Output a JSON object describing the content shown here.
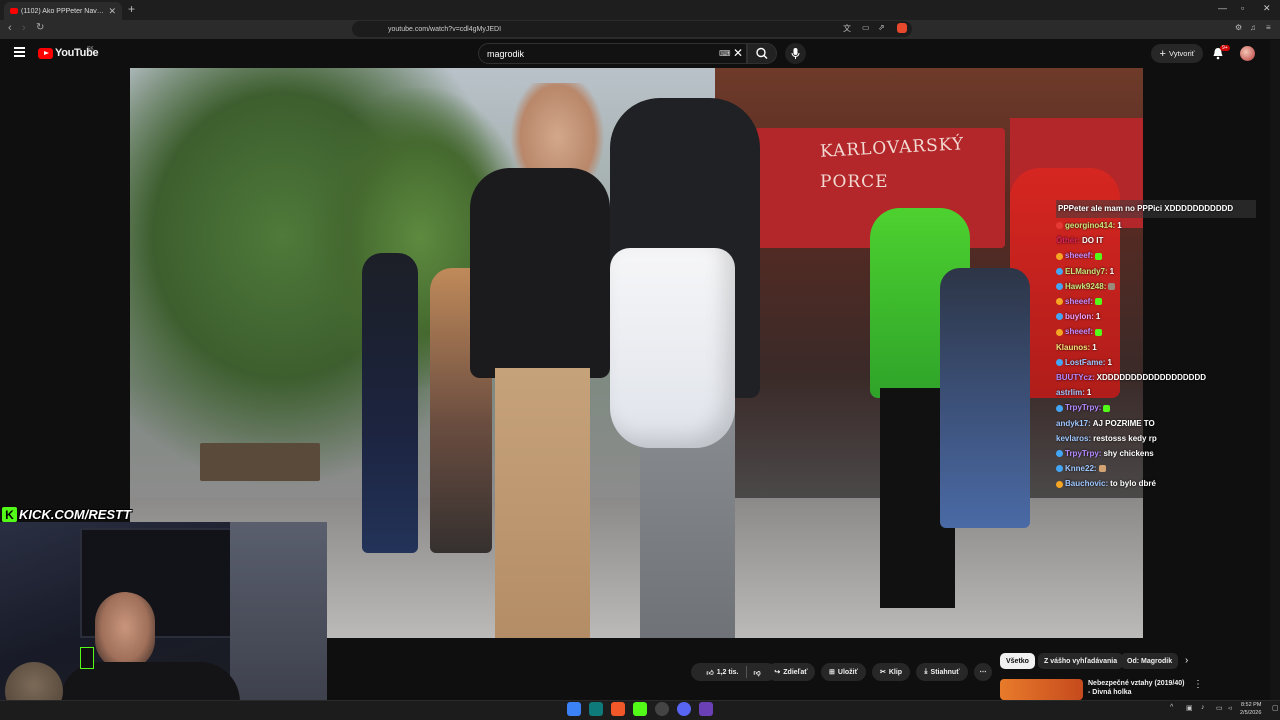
{
  "browser": {
    "tab_title": "(1102) Ako PPPeter Navždy Z",
    "url": "youtube.com/watch?v=cdl4gMyJEDI"
  },
  "youtube": {
    "logo_text": "YouTube",
    "region": "SK",
    "search_value": "magrodik",
    "create_label": "Vytvoriť",
    "notif_count": "9+"
  },
  "stream": {
    "kick_label": "KICK.COM/RESTT"
  },
  "chat": {
    "first_line": "PPPeter ale mam no PPPici XDDDDDDDDDDD",
    "messages": [
      {
        "user": "georgino414:",
        "text": "1",
        "color": "#c8e67a",
        "badge": "#e53935"
      },
      {
        "user": "Ōthér:",
        "text": "DO IT",
        "color": "#e0245e",
        "badge": ""
      },
      {
        "user": "sheeef:",
        "text": "",
        "color": "#c78cff",
        "badge": "#f5a623",
        "emote": "#53fc18"
      },
      {
        "user": "ELMandy7:",
        "text": "1",
        "color": "#c8e67a",
        "badge": "#42a5f5"
      },
      {
        "user": "Hawk9248:",
        "text": "",
        "color": "#c8e67a",
        "badge": "#42a5f5",
        "emote": "#9a8a7a"
      },
      {
        "user": "sheeef:",
        "text": "",
        "color": "#c78cff",
        "badge": "#f5a623",
        "emote": "#53fc18"
      },
      {
        "user": "buylon:",
        "text": "1",
        "color": "#f1a0ff",
        "badge": "#42a5f5"
      },
      {
        "user": "sheeef:",
        "text": "",
        "color": "#c78cff",
        "badge": "#f5a623",
        "emote": "#53fc18"
      },
      {
        "user": "Klaunos:",
        "text": "1",
        "color": "#f5e07a",
        "badge": ""
      },
      {
        "user": "LostFame:",
        "text": "1",
        "color": "#9ec7ff",
        "badge": "#42a5f5"
      },
      {
        "user": "BUUTYcz:",
        "text": "XDDDDDDDDDDDDDDDDDD",
        "color": "#b388ff",
        "badge": ""
      },
      {
        "user": "astrlim:",
        "text": "1",
        "color": "#9ec7ff",
        "badge": ""
      },
      {
        "user": "TrpyTrpy:",
        "text": "",
        "color": "#b388ff",
        "badge": "#42a5f5",
        "emote": "#53fc18"
      },
      {
        "user": "andyk17:",
        "text": "AJ POZRIME TO",
        "color": "#9ec7ff",
        "badge": ""
      },
      {
        "user": "kevlaros:",
        "text": "restosss kedy rp",
        "color": "#9ec7ff",
        "badge": ""
      },
      {
        "user": "TrpyTrpy:",
        "text": "shy chickens",
        "color": "#b388ff",
        "badge": "#42a5f5"
      },
      {
        "user": "Knne22:",
        "text": "",
        "color": "#9ec7ff",
        "badge": "#42a5f5",
        "emote": "#d4a373"
      },
      {
        "user": "Bauchovic:",
        "text": "to bylo dbré",
        "color": "#9ec7ff",
        "badge": "#f5a623"
      }
    ]
  },
  "actions": {
    "likes": "1,2 tis.",
    "share": "Zdieľať",
    "save": "Uložiť",
    "clip": "Klip",
    "download": "Stiahnuť"
  },
  "chips": [
    "Všetko",
    "Z vášho vyhľadávania",
    "Od: Magrodik"
  ],
  "related": {
    "title": "Nebezpečné vztahy (2019/40) - Divná holka"
  },
  "taskbar": {
    "time": "8:52 PM",
    "date": "2/5/2026"
  },
  "colors": {
    "youtube_red": "#ff0000",
    "kick_green": "#53fc18"
  }
}
